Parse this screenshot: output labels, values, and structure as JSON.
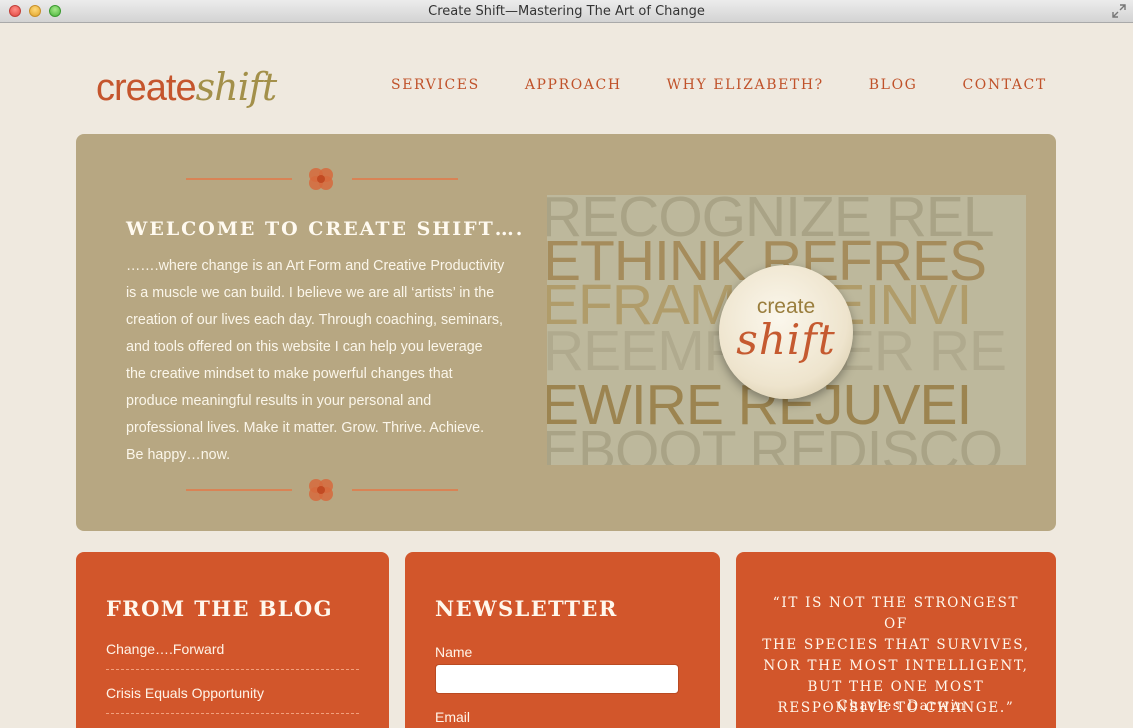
{
  "window": {
    "title": "Create Shift—Mastering The Art of Change"
  },
  "logo": {
    "part1": "create",
    "part2": "shift"
  },
  "nav": {
    "items": [
      {
        "label": "SERVICES"
      },
      {
        "label": "APPROACH"
      },
      {
        "label": "WHY ELIZABETH?"
      },
      {
        "label": "BLOG"
      },
      {
        "label": "CONTACT"
      }
    ]
  },
  "hero": {
    "title": "WELCOME TO CREATE SHIFT….",
    "lines": [
      "…….where change is an Art Form and Creative Productivity",
      "is a muscle we can build. I believe we are all ‘artists’ in the",
      "creation of our lives each day. Through coaching, seminars,",
      "and tools offered on this website I can help you leverage",
      "the creative mindset to make powerful changes that",
      "produce meaningful results in your personal and",
      "professional lives. Make it matter. Grow. Thrive. Achieve.",
      "Be happy…now."
    ],
    "image": {
      "words": [
        "RECOGNIZE REL",
        "ETHINK REFRES",
        "EFRAME REINVI",
        "REEMPOWER RE",
        "EWIRE REJUVEI",
        "EBOOT REDISCO"
      ],
      "badge_line1": "create",
      "badge_line2": "shift"
    }
  },
  "blog": {
    "title": "FROM THE BLOG",
    "posts": [
      {
        "title": "Change….Forward"
      },
      {
        "title": "Crisis Equals Opportunity"
      }
    ]
  },
  "newsletter": {
    "title": "NEWSLETTER",
    "name_label": "Name",
    "email_label": "Email"
  },
  "quote": {
    "lines": [
      "“IT IS NOT THE STRONGEST OF",
      "THE SPECIES THAT SURVIVES,",
      "NOR THE MOST INTELLIGENT,",
      "BUT THE ONE MOST",
      "RESPONSIVE TO CHANGE.”"
    ],
    "author": "- Charles Darwin"
  },
  "colors": {
    "accent": "#d2562b",
    "hero_bg": "#b7a782",
    "page_bg": "#efe9df"
  }
}
